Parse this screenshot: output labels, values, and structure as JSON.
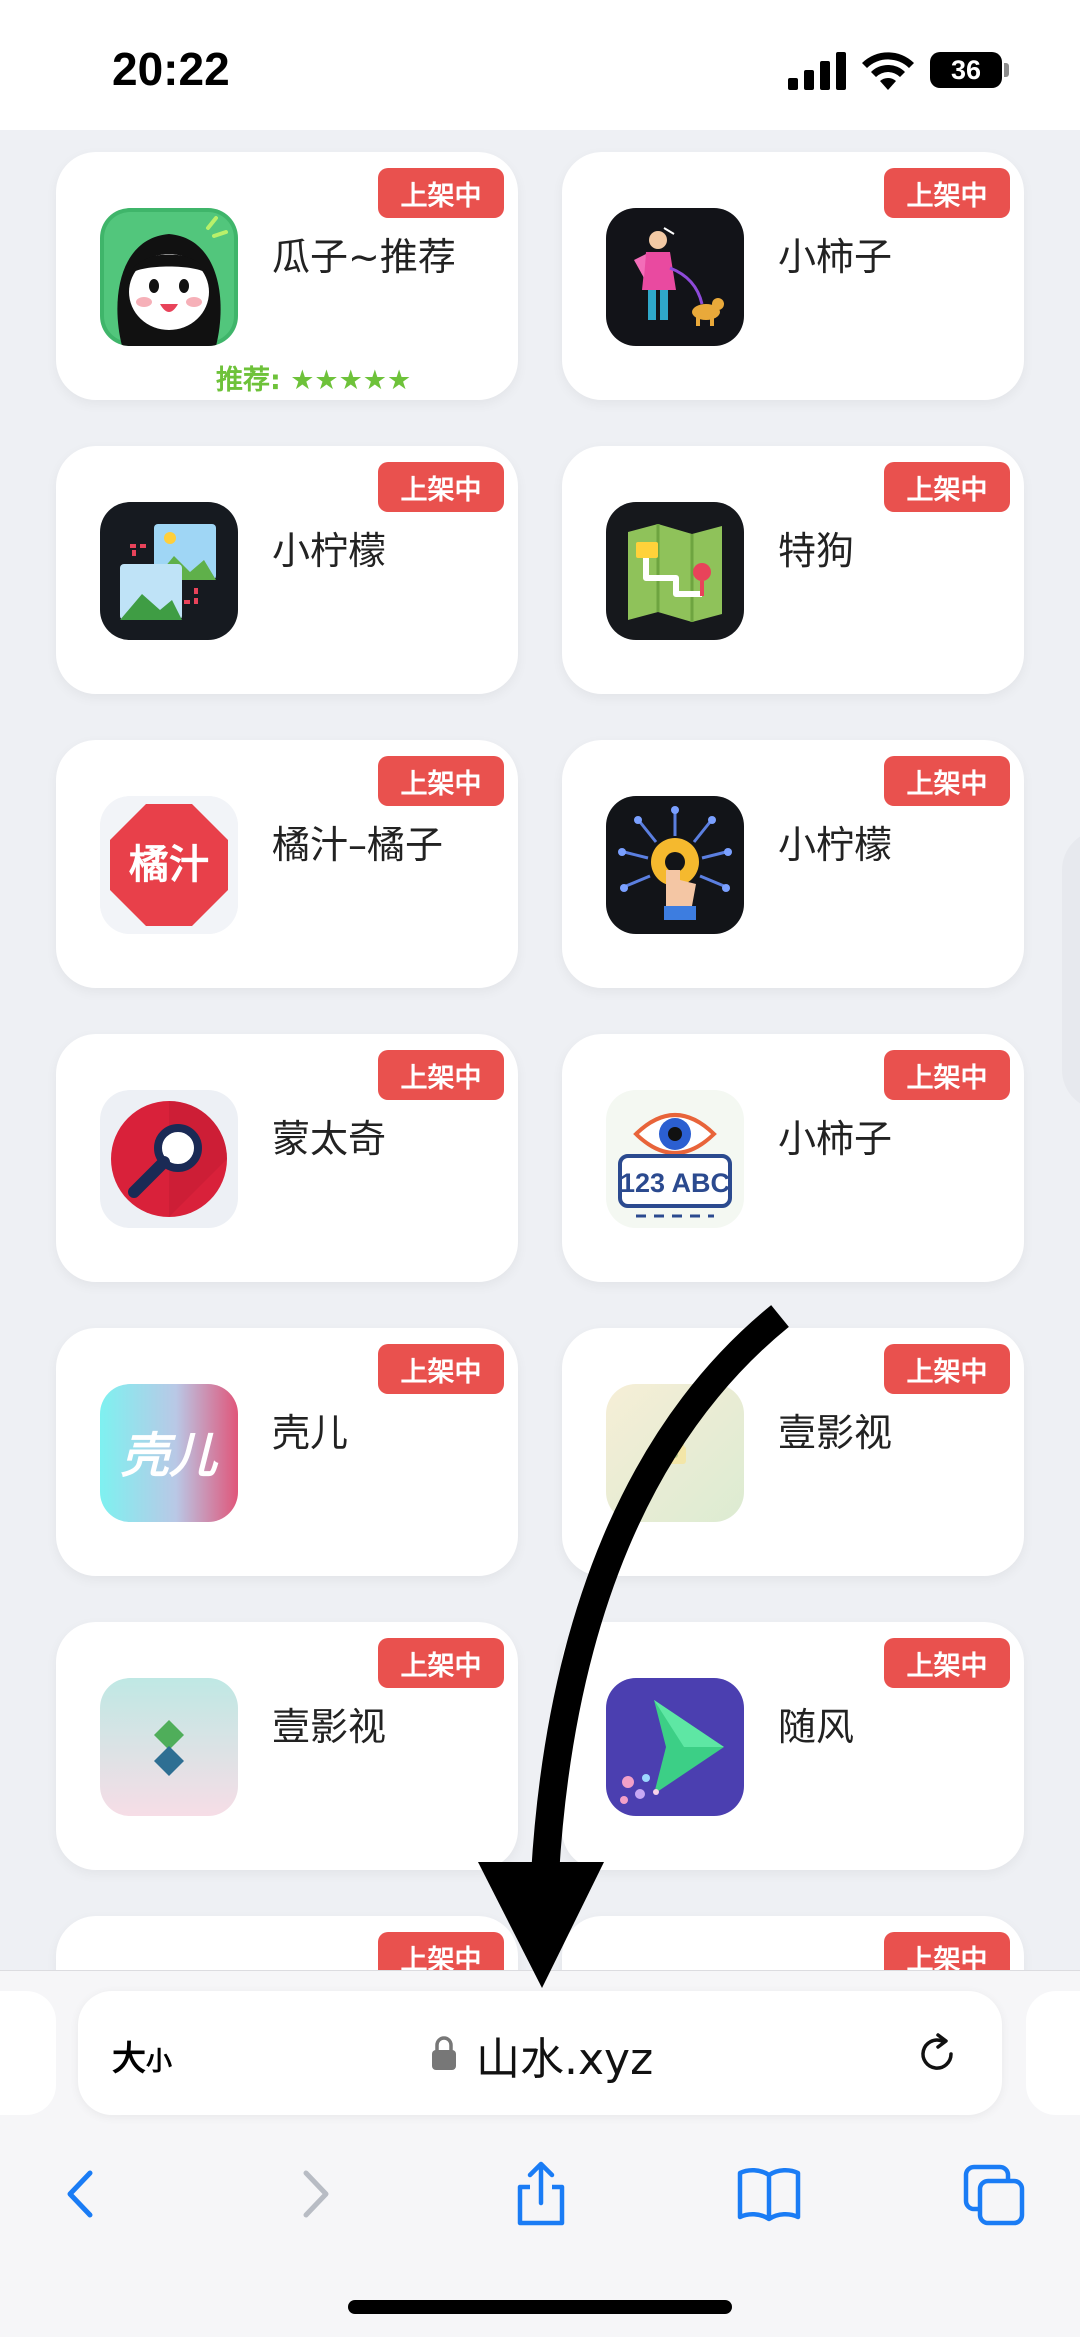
{
  "status_bar": {
    "time": "20:22",
    "battery": "36",
    "icons": [
      "signal-icon",
      "wifi-icon",
      "battery-icon"
    ]
  },
  "badge_label": "上架中",
  "apps": [
    {
      "name": "瓜子~推荐",
      "icon": "cartoon-girl-icon",
      "recommend": "推荐: ★★★★★"
    },
    {
      "name": "小柿子",
      "icon": "person-with-dog-icon"
    },
    {
      "name": "小柠檬",
      "icon": "photo-gallery-icon"
    },
    {
      "name": "特狗",
      "icon": "map-route-icon"
    },
    {
      "name": "橘汁–橘子",
      "icon": "orange-juice-stop-icon",
      "icon_text": "橘汁"
    },
    {
      "name": "小柠檬",
      "icon": "circuit-gear-hand-icon"
    },
    {
      "name": "蒙太奇",
      "icon": "magnifier-icon"
    },
    {
      "name": "小柿子",
      "icon": "eye-plate-icon",
      "icon_text": "123 ABC"
    },
    {
      "name": "壳儿",
      "icon": "gradient-text-icon",
      "icon_text": "壳儿"
    },
    {
      "name": "壹影视",
      "icon": "pastel-lock-icon"
    },
    {
      "name": "壹影视",
      "icon": "diamond-tiles-icon"
    },
    {
      "name": "随风",
      "icon": "play-arrow-icon"
    },
    {
      "name": "",
      "icon": ""
    },
    {
      "name": "",
      "icon": ""
    }
  ],
  "browser": {
    "reader_label_big": "大",
    "reader_label_small": "小",
    "url": "山水.xyz",
    "toolbar": [
      "back-icon",
      "forward-icon",
      "share-icon",
      "bookmarks-icon",
      "tabs-icon"
    ]
  },
  "colors": {
    "badge": "#e9514e",
    "recommend": "#6ec23a",
    "page_bg": "#eef0f4",
    "ios_blue": "#1a7cf5"
  }
}
